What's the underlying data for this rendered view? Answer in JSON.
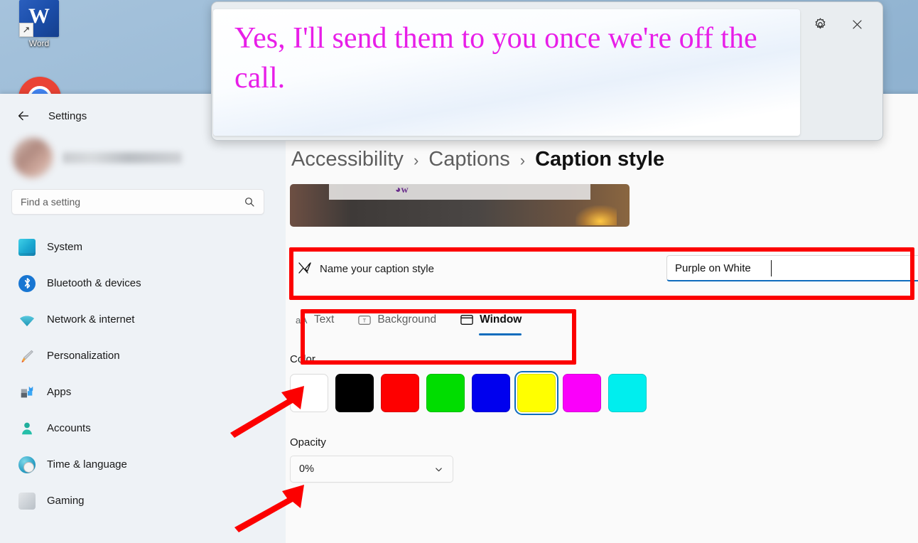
{
  "desktop": {
    "icons": [
      {
        "name": "Word",
        "glyph": "W"
      },
      {
        "name": "Chrome",
        "glyph": ""
      }
    ]
  },
  "caption_overlay": {
    "text": "Yes, I'll send them to you once we're off the call.",
    "text_color": "#e81ee8",
    "settings_icon": "gear-icon",
    "close_icon": "close-icon",
    "close_glyph": "✕"
  },
  "settings": {
    "header": {
      "back_label": "←",
      "title": "Settings"
    },
    "search": {
      "placeholder": "Find a setting",
      "icon": "search-icon"
    },
    "sidebar": {
      "items": [
        {
          "label": "System",
          "icon": "system-icon"
        },
        {
          "label": "Bluetooth & devices",
          "icon": "bluetooth-icon"
        },
        {
          "label": "Network & internet",
          "icon": "network-icon"
        },
        {
          "label": "Personalization",
          "icon": "paintbrush-icon"
        },
        {
          "label": "Apps",
          "icon": "apps-icon"
        },
        {
          "label": "Accounts",
          "icon": "account-icon"
        },
        {
          "label": "Time & language",
          "icon": "clock-icon"
        },
        {
          "label": "Gaming",
          "icon": "gaming-icon"
        }
      ]
    },
    "breadcrumb": {
      "items": [
        "Accessibility",
        "Captions"
      ],
      "separator": "›",
      "current": "Caption style"
    },
    "name_row": {
      "icon": "paintbrush-icon",
      "label": "Name your caption style",
      "value": "Purple on White",
      "placeholder": "Name your caption style"
    },
    "tabs": [
      {
        "label": "Text",
        "icon": "text-format-icon",
        "glyph": "aA",
        "selected": false
      },
      {
        "label": "Background",
        "icon": "background-icon",
        "glyph": "T",
        "selected": false
      },
      {
        "label": "Window",
        "icon": "window-icon",
        "glyph": "☐",
        "selected": true
      }
    ],
    "color_section": {
      "label": "Color",
      "swatches": [
        {
          "name": "White",
          "hex": "#ffffff",
          "selected": false
        },
        {
          "name": "Black",
          "hex": "#000000",
          "selected": false
        },
        {
          "name": "Red",
          "hex": "#fe0000",
          "selected": false
        },
        {
          "name": "Green",
          "hex": "#00dd00",
          "selected": false
        },
        {
          "name": "Blue",
          "hex": "#0000ee",
          "selected": false
        },
        {
          "name": "Yellow",
          "hex": "#ffff00",
          "selected": true
        },
        {
          "name": "Magenta",
          "hex": "#fa00fa",
          "selected": false
        },
        {
          "name": "Cyan",
          "hex": "#00eeee",
          "selected": false
        }
      ]
    },
    "opacity_section": {
      "label": "Opacity",
      "value": "0%",
      "chevron": "chevron-down-icon"
    }
  },
  "annotations": {
    "highlight_color": "#fc0000",
    "boxes": [
      "name-your-caption-style-row",
      "style-tabs"
    ],
    "arrows": [
      "arrow-to-color-section",
      "arrow-to-opacity-section"
    ]
  }
}
